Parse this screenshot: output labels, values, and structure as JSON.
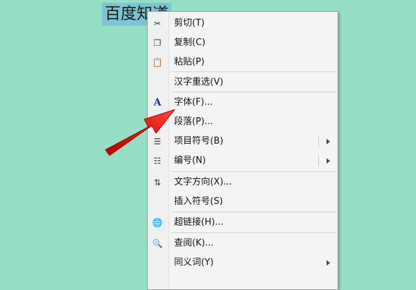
{
  "document": {
    "selected_text": "百度知道"
  },
  "context_menu": {
    "items": [
      {
        "label": "剪切(T)",
        "icon": "scissors-icon",
        "glyph": "✂"
      },
      {
        "label": "复制(C)",
        "icon": "copy-icon",
        "glyph": "❐"
      },
      {
        "label": "粘贴(P)",
        "icon": "paste-icon",
        "glyph": "📋"
      },
      {
        "label": "汉字重选(V)",
        "icon": "",
        "glyph": ""
      },
      {
        "label": "字体(F)...",
        "icon": "font-icon",
        "glyph": "A"
      },
      {
        "label": "段落(P)...",
        "icon": "paragraph-icon",
        "glyph": "¶"
      },
      {
        "label": "项目符号(B)",
        "icon": "bullets-icon",
        "glyph": "☰"
      },
      {
        "label": "编号(N)",
        "icon": "numbering-icon",
        "glyph": "☷"
      },
      {
        "label": "文字方向(X)...",
        "icon": "text-direction-icon",
        "glyph": "⇅"
      },
      {
        "label": "插入符号(S)",
        "icon": "",
        "glyph": ""
      },
      {
        "label": "超链接(H)...",
        "icon": "hyperlink-icon",
        "glyph": "🌐"
      },
      {
        "label": "查阅(K)...",
        "icon": "lookup-icon",
        "glyph": "🔍"
      },
      {
        "label": "同义词(Y)",
        "icon": "",
        "glyph": ""
      }
    ]
  },
  "colors": {
    "background": "#96dfc5",
    "selection_highlight": "#7ec3d4",
    "menu_background": "#f4f4f4",
    "annotation_arrow": "#e01010"
  }
}
